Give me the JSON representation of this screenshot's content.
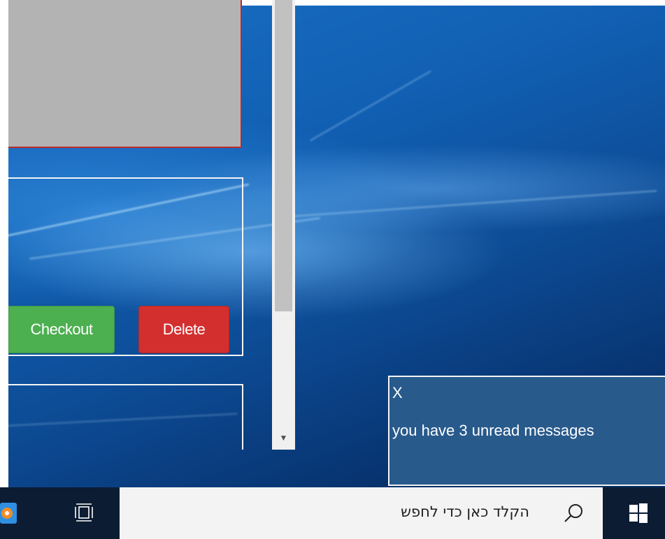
{
  "app": {
    "checkout_label": "Checkout",
    "delete_label": "Delete",
    "accent_green": "#4caf50",
    "accent_red": "#d32f2f"
  },
  "notification": {
    "close_label": "X",
    "message": "you have 3 unread messages",
    "background": "#285a8c"
  },
  "taskbar": {
    "search_placeholder": "הקלד כאן כדי לחפש",
    "icons": [
      "app-icon",
      "task-view-icon",
      "search-icon",
      "windows-start-icon"
    ]
  },
  "scrollbar": {
    "arrow_glyph": "▼"
  }
}
